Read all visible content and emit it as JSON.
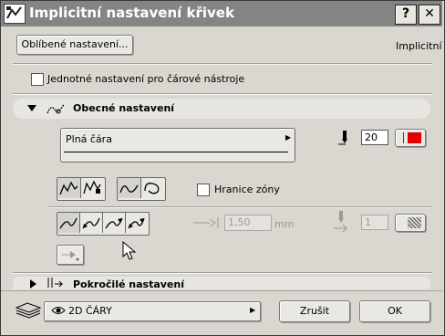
{
  "window": {
    "title": "Implicitní nastavení křivek",
    "help_label": "?",
    "close_label": "✕"
  },
  "top": {
    "favorites_button": "Oblíbené nastavení...",
    "mode_label": "Implicitní"
  },
  "uniform_checkbox": {
    "label": "Jednotné nastavení pro čárové nástroje",
    "checked": false
  },
  "general": {
    "header": "Obecné nastavení",
    "line_type": "Plná čára",
    "pen_value": "20",
    "pen_color": "#e00000",
    "zone_checkbox": {
      "label": "Hranice zóny",
      "checked": false
    }
  },
  "arrows": {
    "size_value": "1,50",
    "size_unit": "mm",
    "arrow_pen_value": "1"
  },
  "advanced": {
    "header": "Pokročilé nastavení"
  },
  "bottom": {
    "layer_name": "2D ČÁRY",
    "cancel_label": "Zrušit",
    "ok_label": "OK"
  }
}
